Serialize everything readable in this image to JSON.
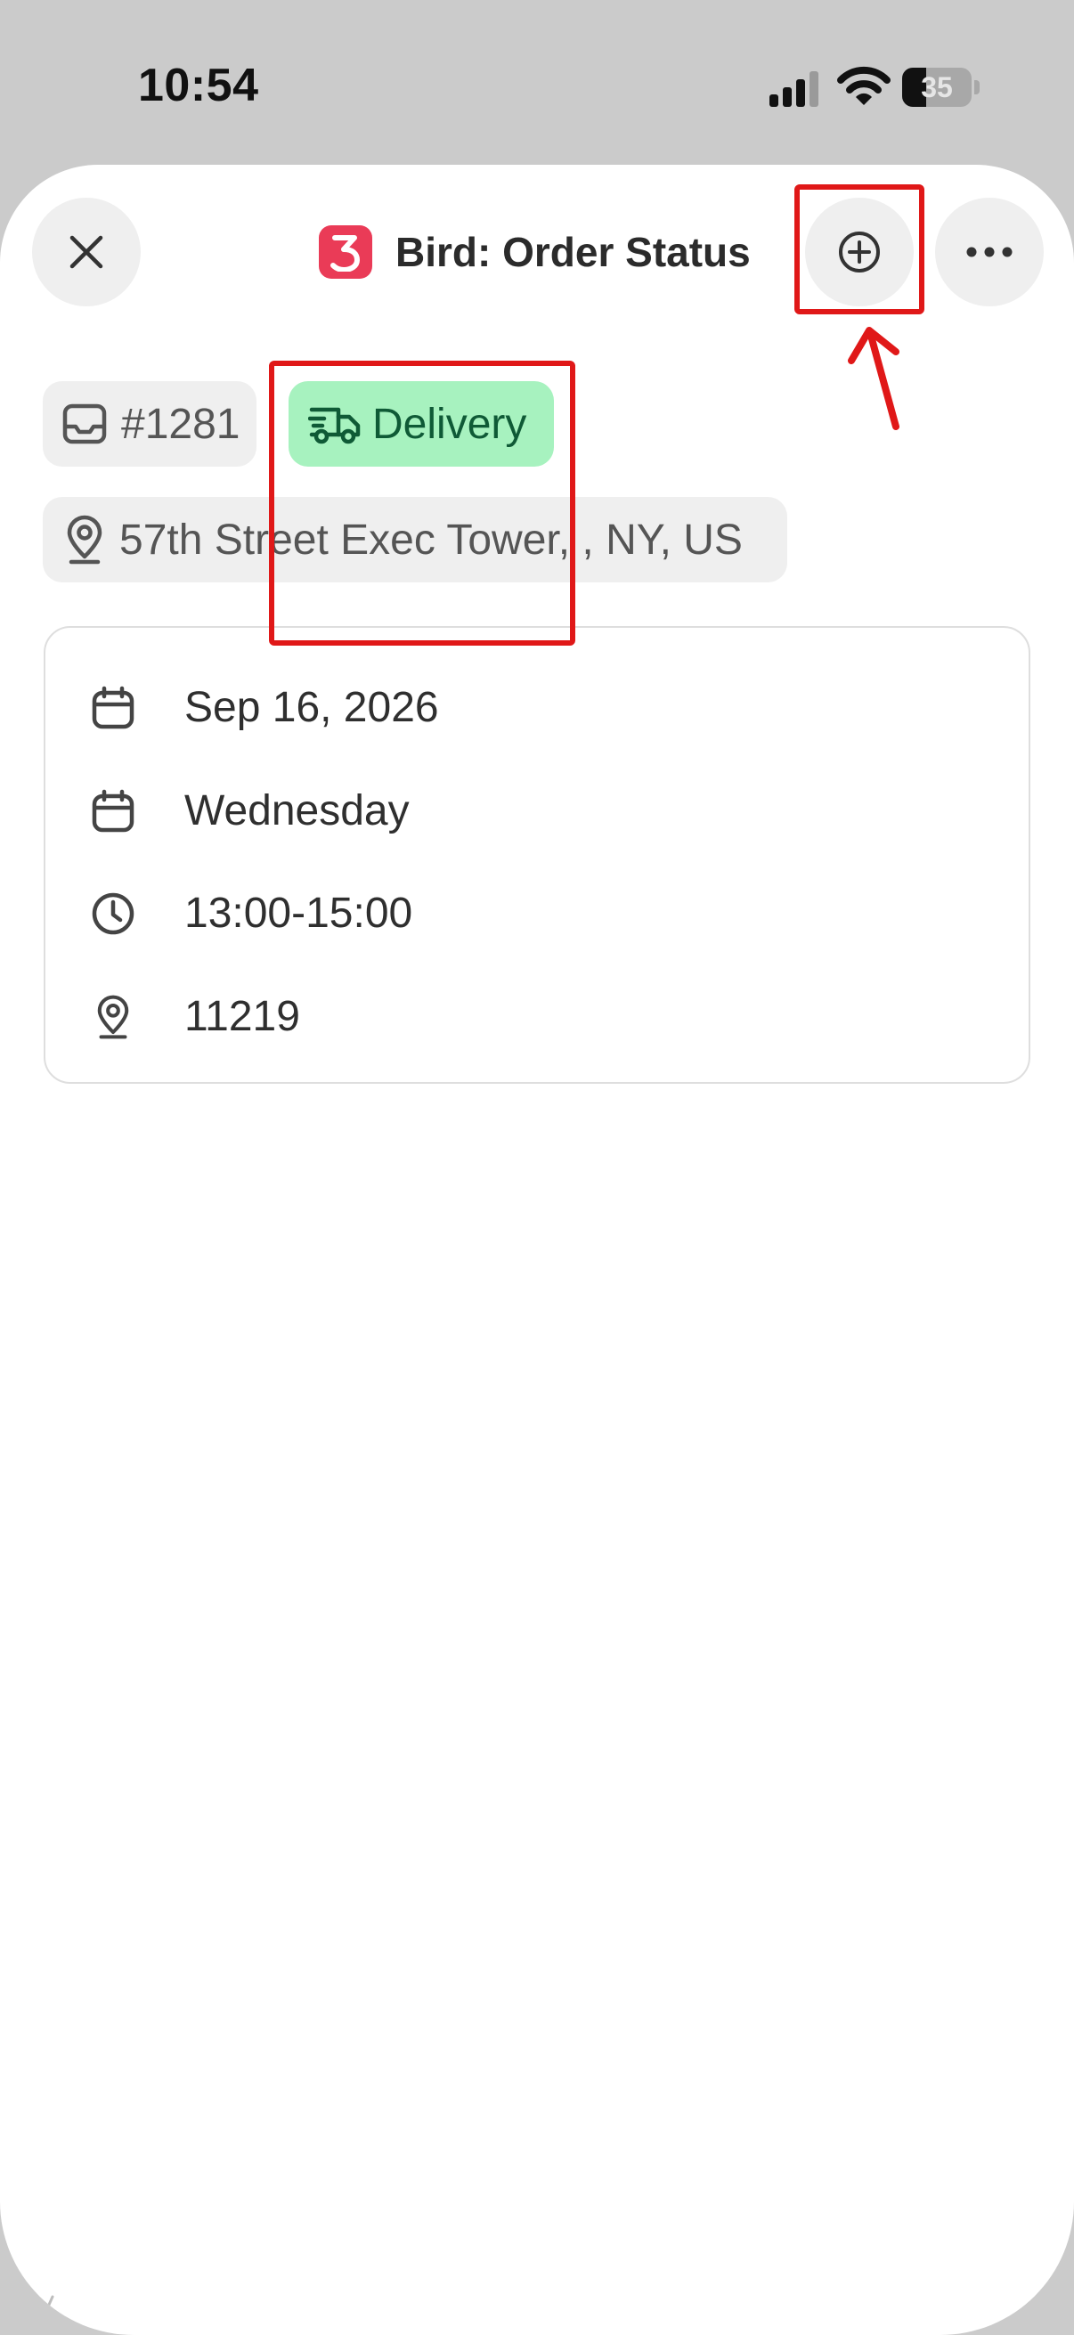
{
  "status_bar": {
    "time": "10:54",
    "battery_level": "35",
    "battery_fraction": 0.35
  },
  "header": {
    "title": "Bird: Order Status",
    "logo_letter": "3",
    "logo_color": "#ea3b57",
    "close_icon": "close-icon",
    "add_icon": "plus-circle-icon",
    "more_icon": "more-horizontal-icon"
  },
  "chips": {
    "order_number": "#1281",
    "order_icon": "inbox-tray-icon",
    "delivery_label": "Delivery",
    "delivery_icon": "delivery-truck-icon",
    "delivery_bg": "#a7f2bf",
    "delivery_fg": "#0f5a36",
    "address": "57th Street Exec Tower, , NY, US",
    "address_icon": "map-pin-icon"
  },
  "details": [
    {
      "icon": "calendar-icon",
      "text": "Sep 16, 2026"
    },
    {
      "icon": "calendar-icon",
      "text": "Wednesday"
    },
    {
      "icon": "clock-icon",
      "text": "13:00-15:00"
    },
    {
      "icon": "map-pin-icon",
      "text": "11219"
    }
  ],
  "annotations": {
    "highlight_color": "#e01818"
  }
}
